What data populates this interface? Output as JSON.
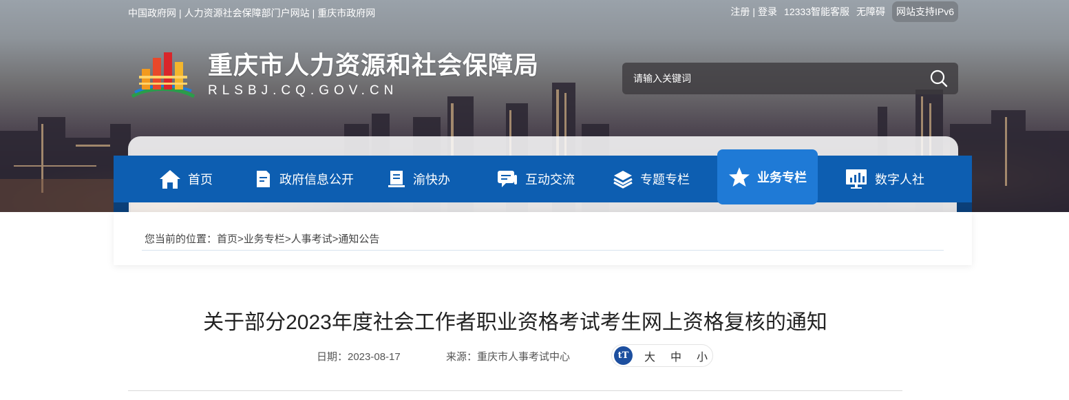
{
  "top_bar": {
    "left_links": [
      "中国政府网",
      "人力资源社会保障部门户网站",
      "重庆市政府网"
    ],
    "separator": "|",
    "right_links": [
      "注册",
      "登录",
      "12333智能客服",
      "无障碍"
    ],
    "ipv6_badge": "网站支持IPv6"
  },
  "header": {
    "site_name": "重庆市人力资源和社会保障局",
    "site_domain": "RLSBJ.CQ.GOV.CN",
    "logo_icon": "chongqing-hrss-logo"
  },
  "search": {
    "placeholder": "请输入关键词",
    "icon": "search-icon"
  },
  "nav": {
    "items": [
      {
        "label": "首页",
        "icon": "home-icon"
      },
      {
        "label": "政府信息公开",
        "icon": "document-icon"
      },
      {
        "label": "渝快办",
        "icon": "notebook-icon"
      },
      {
        "label": "互动交流",
        "icon": "chat-icon"
      },
      {
        "label": "专题专栏",
        "icon": "layers-icon"
      },
      {
        "label": "业务专栏",
        "icon": "star-icon",
        "active": true
      },
      {
        "label": "数字人社",
        "icon": "monitor-chart-icon"
      }
    ]
  },
  "breadcrumb": {
    "prefix": "您当前的位置：",
    "items": [
      "首页",
      "业务专栏",
      "人事考试",
      "通知公告"
    ],
    "separator": ">"
  },
  "article": {
    "title": "关于部分2023年度社会工作者职业资格考试考生网上资格复核的通知",
    "date_label": "日期：2023-08-17",
    "source_label": "来源：重庆市人事考试中心",
    "font_size": {
      "badge": "tT",
      "options": [
        "大",
        "中",
        "小"
      ]
    }
  },
  "colors": {
    "nav_bg": "#0d5eb1",
    "nav_active": "#1f7ad6",
    "text_dark": "#222222"
  }
}
